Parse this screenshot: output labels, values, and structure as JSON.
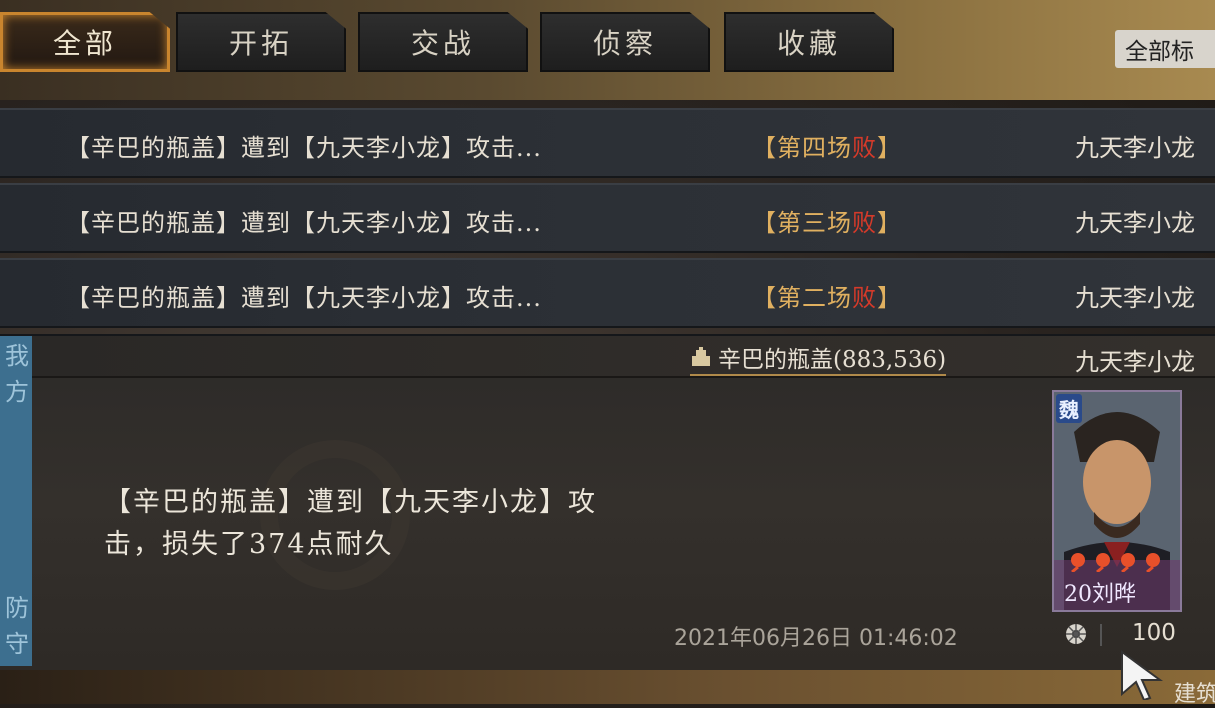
{
  "tabs": [
    {
      "label": "全部",
      "active": true
    },
    {
      "label": "开拓",
      "active": false
    },
    {
      "label": "交战",
      "active": false
    },
    {
      "label": "侦察",
      "active": false
    },
    {
      "label": "收藏",
      "active": false
    }
  ],
  "filter_button": "全部标",
  "reports": [
    {
      "message": "【辛巴的瓶盖】遭到【九天李小龙】攻击...",
      "round_prefix": "【第四场",
      "result": "败",
      "round_suffix": "】",
      "attacker": "九天李小龙"
    },
    {
      "message": "【辛巴的瓶盖】遭到【九天李小龙】攻击...",
      "round_prefix": "【第三场",
      "result": "败",
      "round_suffix": "】",
      "attacker": "九天李小龙"
    },
    {
      "message": "【辛巴的瓶盖】遭到【九天李小龙】攻击...",
      "round_prefix": "【第二场",
      "result": "败",
      "round_suffix": "】",
      "attacker": "九天李小龙"
    }
  ],
  "detail": {
    "side_top": [
      "我",
      "方"
    ],
    "side_bottom": [
      "防",
      "守"
    ],
    "target": "辛巴的瓶盖(883,536)",
    "attacker": "九天李小龙",
    "description": "【辛巴的瓶盖】遭到【九天李小龙】攻击，损失了374点耐久",
    "timestamp": "2021年06月26日 01:46:02",
    "hero": {
      "faction": "魏",
      "name": "20刘晔",
      "stars": 4
    },
    "troops": "100",
    "bottom_text": "建筑"
  },
  "colors": {
    "accent": "#c9852e",
    "lose": "#d43a2a",
    "round": "#e0b060",
    "side": "#3d6f8f"
  }
}
